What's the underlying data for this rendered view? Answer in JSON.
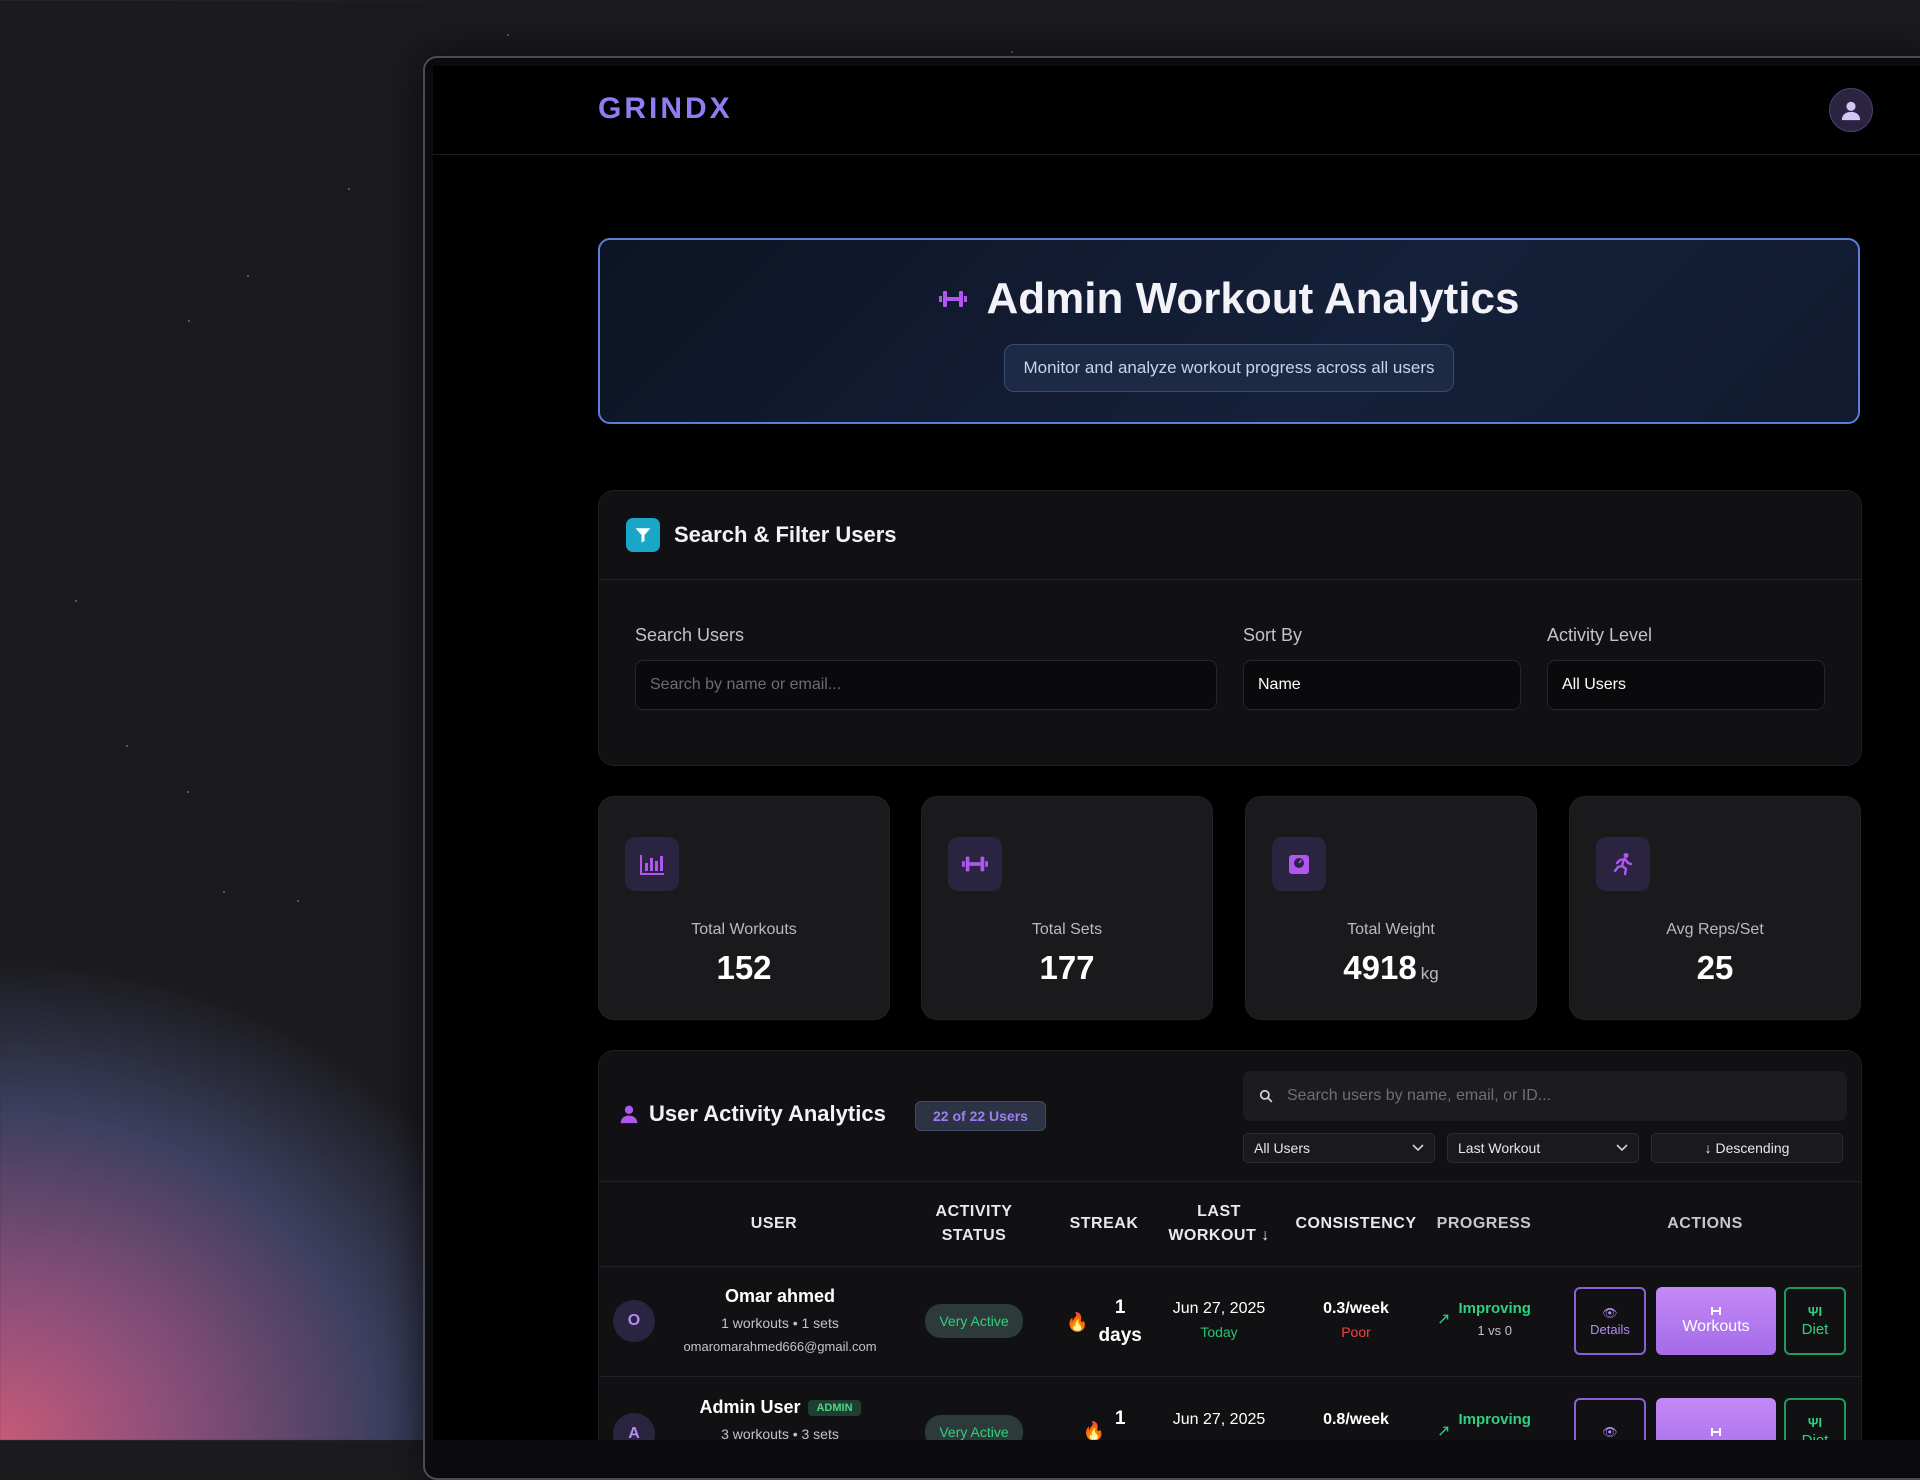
{
  "app": {
    "logo": "GRINDX"
  },
  "hero": {
    "title": "Admin Workout Analytics",
    "subtitle": "Monitor and analyze workout progress across all users"
  },
  "filter": {
    "title": "Search & Filter Users",
    "search_label": "Search Users",
    "search_placeholder": "Search by name or email...",
    "sort_label": "Sort By",
    "sort_value": "Name",
    "activity_label": "Activity Level",
    "activity_value": "All Users"
  },
  "stats": [
    {
      "label": "Total Workouts",
      "value": "152",
      "unit": "",
      "icon": "bar-chart-icon"
    },
    {
      "label": "Total Sets",
      "value": "177",
      "unit": "",
      "icon": "dumbbell-icon"
    },
    {
      "label": "Total Weight",
      "value": "4918",
      "unit": "kg",
      "icon": "weight-icon"
    },
    {
      "label": "Avg Reps/Set",
      "value": "25",
      "unit": "",
      "icon": "running-icon"
    }
  ],
  "activity": {
    "title": "User Activity Analytics",
    "badge": "22 of 22 Users",
    "search_placeholder": "Search users by name, email, or ID...",
    "filter_value": "All Users",
    "sort_value": "Last Workout",
    "order_label": "↓ Descending",
    "columns": {
      "user": "USER",
      "status_1": "ACTIVITY",
      "status_2": "STATUS",
      "streak": "STREAK",
      "last_1": "LAST",
      "last_2": "WORKOUT ↓",
      "consistency": "CONSISTENCY",
      "progress": "PROGRESS",
      "actions": "ACTIONS"
    },
    "rows": [
      {
        "initial": "O",
        "name": "Omar ahmed",
        "admin": "",
        "meta": "1 workouts • 1 sets",
        "email": "omaromarahmed666@gmail.com",
        "status": "Very Active",
        "streak_num": "1",
        "streak_unit": "days",
        "date": "Jun 27, 2025",
        "date_sub": "Today",
        "consistency": "0.3/week",
        "consistency_sub": "Poor",
        "progress": "Improving",
        "progress_sub": "1 vs 0",
        "details": "Details",
        "workouts": "Workouts",
        "diet": "Diet"
      },
      {
        "initial": "A",
        "name": "Admin User",
        "admin": "ADMIN",
        "meta": "3 workouts • 3 sets",
        "email": "",
        "status": "Very Active",
        "streak_num": "1",
        "streak_unit": "",
        "date": "Jun 27, 2025",
        "date_sub": "",
        "consistency": "0.8/week",
        "consistency_sub": "",
        "progress": "Improving",
        "progress_sub": "",
        "details": "",
        "workouts": "",
        "diet": "Diet"
      }
    ]
  }
}
